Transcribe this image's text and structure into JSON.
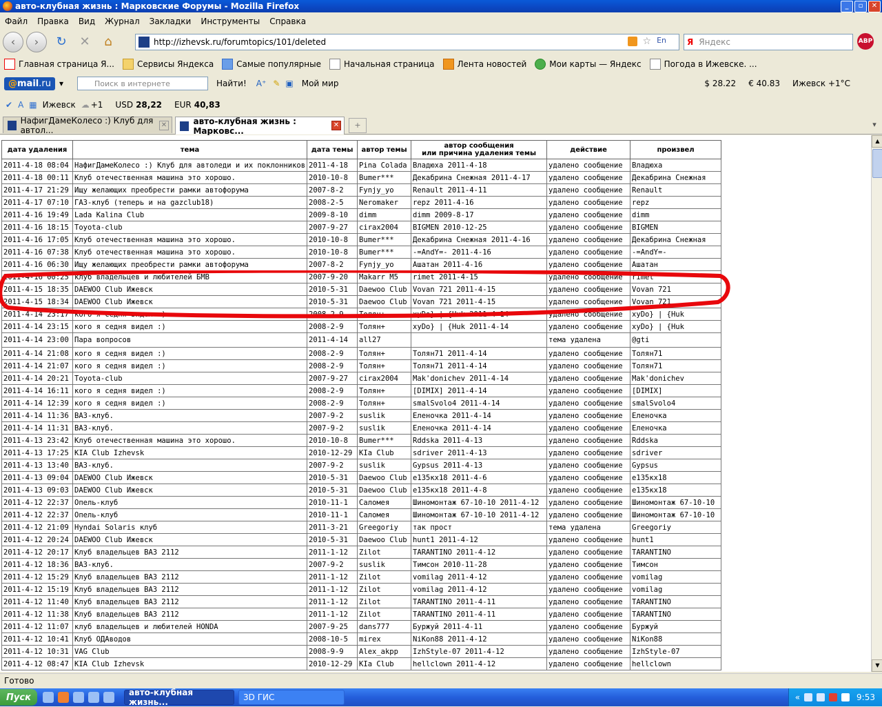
{
  "window": {
    "title": "авто-клубная жизнь : Марковские Форумы - Mozilla Firefox"
  },
  "menu": [
    "Файл",
    "Правка",
    "Вид",
    "Журнал",
    "Закладки",
    "Инструменты",
    "Справка"
  ],
  "nav": {
    "url": "http://izhevsk.ru/forumtopics/101/deleted",
    "lang": "En",
    "search_placeholder": "Яндекс",
    "abp": "ABP"
  },
  "bookmarks": [
    "Главная страница Я...",
    "Сервисы Яндекса",
    "Самые популярные",
    "Начальная страница",
    "Лента новостей",
    "Мои карты — Яндекс",
    "Погода в Ижевске. ..."
  ],
  "mailbar": {
    "logo_prefix": "@",
    "logo_main": "mail",
    "logo_suffix": ".ru",
    "search_placeholder": "Поиск в интернете",
    "find": "Найти!",
    "myworld": "Мой мир",
    "rate_usd": "$ 28.22",
    "rate_eur": "€ 40.83",
    "weather": "Ижевск +1°C"
  },
  "toolbar2": {
    "city": "Ижевск",
    "temp": "+1",
    "usd_label": "USD",
    "usd_value": "28,22",
    "eur_label": "EUR",
    "eur_value": "40,83"
  },
  "tabs": [
    {
      "label": "НафигДамеКолесо :) Клуб для автол...",
      "active": false
    },
    {
      "label": "авто-клубная жизнь : Марковс...",
      "active": true
    }
  ],
  "table": {
    "headers": [
      "дата удаления",
      "тема",
      "дата темы",
      "автор темы",
      "автор сообщения\nили причина удаления темы",
      "действие",
      "произвел"
    ],
    "rows": [
      [
        "2011-4-18 08:04",
        "НафигДамеКолесо :) Клуб для автоледи и их поклонников",
        "2011-4-18",
        "Pina Colada",
        "Владюха 2011-4-18",
        "удалено сообщение",
        "Владюха"
      ],
      [
        "2011-4-18 00:11",
        "Клуб отечественная машина это хорошо.",
        "2010-10-8",
        "Bumer***",
        "Декабрина Снежная 2011-4-17",
        "удалено сообщение",
        "Декабрина Снежная"
      ],
      [
        "2011-4-17 21:29",
        "Ищу желающих преобрести рамки автофорума",
        "2007-8-2",
        "Fynjy_yo",
        "Renault 2011-4-11",
        "удалено сообщение",
        "Renault"
      ],
      [
        "2011-4-17 07:10",
        "ГАЗ-клуб (теперь и на gazclub18)",
        "2008-2-5",
        "Neromaker",
        "repz 2011-4-16",
        "удалено сообщение",
        "repz"
      ],
      [
        "2011-4-16 19:49",
        "Lada Kalina Club",
        "2009-8-10",
        "dimm",
        "dimm 2009-8-17",
        "удалено сообщение",
        "dimm"
      ],
      [
        "2011-4-16 18:15",
        "Toyota-club",
        "2007-9-27",
        "cirax2004",
        "BIGMEN 2010-12-25",
        "удалено сообщение",
        "BIGMEN"
      ],
      [
        "2011-4-16 17:05",
        "Клуб отечественная машина это хорошо.",
        "2010-10-8",
        "Bumer***",
        "Декабрина Снежная 2011-4-16",
        "удалено сообщение",
        "Декабрина Снежная"
      ],
      [
        "2011-4-16 07:38",
        "Клуб отечественная машина это хорошо.",
        "2010-10-8",
        "Bumer***",
        "-=AndY=- 2011-4-16",
        "удалено сообщение",
        "-=AndY=-"
      ],
      [
        "2011-4-16 06:30",
        "Ищу желающих преобрести рамки автофорума",
        "2007-8-2",
        "Fynjy_yo",
        "Ашатан 2011-4-16",
        "удалено сообщение",
        "Ашатан"
      ],
      [
        "2011-4-16 00:25",
        "клуб владельцев и любителей БМВ",
        "2007-9-20",
        "Makarr M5",
        "rimet 2011-4-15",
        "удалено сообщение",
        "rimet"
      ],
      [
        "2011-4-15 18:35",
        "DAEWOO Club Ижевск",
        "2010-5-31",
        "Daewoo Club",
        "Vovan 721 2011-4-15",
        "удалено сообщение",
        "Vovan 721"
      ],
      [
        "2011-4-15 18:34",
        "DAEWOO Club Ижевск",
        "2010-5-31",
        "Daewoo Club",
        "Vovan 721 2011-4-15",
        "удалено сообщение",
        "Vovan 721"
      ],
      [
        "2011-4-14 23:17",
        "кого я седня видел :)",
        "2008-2-9",
        "Толян+",
        "xyDo} | {Huk 2011-4-14",
        "удалено сообщение",
        "xyDo} | {Huk"
      ],
      [
        "2011-4-14 23:15",
        "кого я седня видел :)",
        "2008-2-9",
        "Толян+",
        "xyDo} | {Huk 2011-4-14",
        "удалено сообщение",
        "xyDo} | {Huk"
      ],
      [
        "2011-4-14 23:00",
        "Пара вопросов",
        "2011-4-14",
        "all27",
        "",
        "тема удалена",
        "@gti"
      ],
      [
        "2011-4-14 21:08",
        "кого я седня видел :)",
        "2008-2-9",
        "Толян+",
        "Толян71 2011-4-14",
        "удалено сообщение",
        "Толян71"
      ],
      [
        "2011-4-14 21:07",
        "кого я седня видел :)",
        "2008-2-9",
        "Толян+",
        "Толян71 2011-4-14",
        "удалено сообщение",
        "Толян71"
      ],
      [
        "2011-4-14 20:21",
        "Toyota-club",
        "2007-9-27",
        "cirax2004",
        "Mak'donichev 2011-4-14",
        "удалено сообщение",
        "Mak'donichev"
      ],
      [
        "2011-4-14 16:11",
        "кого я седня видел :)",
        "2008-2-9",
        "Толян+",
        "[DIMIX] 2011-4-14",
        "удалено сообщение",
        "[DIMIX]"
      ],
      [
        "2011-4-14 12:39",
        "кого я седня видел :)",
        "2008-2-9",
        "Толян+",
        "smalSvolo4 2011-4-14",
        "удалено сообщение",
        "smalSvolo4"
      ],
      [
        "2011-4-14 11:36",
        "ВАЗ-клуб.",
        "2007-9-2",
        "suslik",
        "Еленочка 2011-4-14",
        "удалено сообщение",
        "Еленочка"
      ],
      [
        "2011-4-14 11:31",
        "ВАЗ-клуб.",
        "2007-9-2",
        "suslik",
        "Еленочка 2011-4-14",
        "удалено сообщение",
        "Еленочка"
      ],
      [
        "2011-4-13 23:42",
        "Клуб отечественная машина это хорошо.",
        "2010-10-8",
        "Bumer***",
        "Rddska 2011-4-13",
        "удалено сообщение",
        "Rddska"
      ],
      [
        "2011-4-13 17:25",
        "KIA Club Izhevsk",
        "2010-12-29",
        "KIa Club",
        "sdriver 2011-4-13",
        "удалено сообщение",
        "sdriver"
      ],
      [
        "2011-4-13 13:40",
        "ВАЗ-клуб.",
        "2007-9-2",
        "suslik",
        "Gypsus 2011-4-13",
        "удалено сообщение",
        "Gypsus"
      ],
      [
        "2011-4-13 09:04",
        "DAEWOO Club Ижевск",
        "2010-5-31",
        "Daewoo Club",
        "e135кx18 2011-4-6",
        "удалено сообщение",
        "e135кx18"
      ],
      [
        "2011-4-13 09:03",
        "DAEWOO Club Ижевск",
        "2010-5-31",
        "Daewoo Club",
        "e135кx18 2011-4-8",
        "удалено сообщение",
        "e135кx18"
      ],
      [
        "2011-4-12 22:37",
        "Опель-клуб",
        "2010-11-1",
        "Саломея",
        "Шиномонтаж 67-10-10 2011-4-12",
        "удалено сообщение",
        "Шиномонтаж 67-10-10"
      ],
      [
        "2011-4-12 22:37",
        "Опель-клуб",
        "2010-11-1",
        "Саломея",
        "Шиномонтаж 67-10-10 2011-4-12",
        "удалено сообщение",
        "Шиномонтаж 67-10-10"
      ],
      [
        "2011-4-12 21:09",
        "Hyndai Solaris клуб",
        "2011-3-21",
        "Greegoriy",
        "так прост",
        "тема удалена",
        "Greegoriy"
      ],
      [
        "2011-4-12 20:24",
        "DAEWOO Club Ижевск",
        "2010-5-31",
        "Daewoo Club",
        "hunt1 2011-4-12",
        "удалено сообщение",
        "hunt1"
      ],
      [
        "2011-4-12 20:17",
        "Клуб владельцев ВАЗ 2112",
        "2011-1-12",
        "Zilot",
        "TARANTINO 2011-4-12",
        "удалено сообщение",
        "TARANTINO"
      ],
      [
        "2011-4-12 18:36",
        "ВАЗ-клуб.",
        "2007-9-2",
        "suslik",
        "Тимсон 2010-11-28",
        "удалено сообщение",
        "Тимсон"
      ],
      [
        "2011-4-12 15:29",
        "Клуб владельцев ВАЗ 2112",
        "2011-1-12",
        "Zilot",
        "vomilag 2011-4-12",
        "удалено сообщение",
        "vomilag"
      ],
      [
        "2011-4-12 15:19",
        "Клуб владельцев ВАЗ 2112",
        "2011-1-12",
        "Zilot",
        "vomilag 2011-4-12",
        "удалено сообщение",
        "vomilag"
      ],
      [
        "2011-4-12 11:40",
        "Клуб владельцев ВАЗ 2112",
        "2011-1-12",
        "Zilot",
        "TARANTINO 2011-4-11",
        "удалено сообщение",
        "TARANTINO"
      ],
      [
        "2011-4-12 11:38",
        "Клуб владельцев ВАЗ 2112",
        "2011-1-12",
        "Zilot",
        "TARANTINO 2011-4-11",
        "удалено сообщение",
        "TARANTINO"
      ],
      [
        "2011-4-12 11:07",
        "клуб владельцев и любителей HONDA",
        "2007-9-25",
        "dans777",
        "Буржуй 2011-4-11",
        "удалено сообщение",
        "Буржуй"
      ],
      [
        "2011-4-12 10:41",
        "Клуб ОДАводов",
        "2008-10-5",
        "mirex",
        "NiKon88 2011-4-12",
        "удалено сообщение",
        "NiKon88"
      ],
      [
        "2011-4-12 10:31",
        "VAG Club",
        "2008-9-9",
        "Alex_akpp",
        "IzhStyle-07 2011-4-12",
        "удалено сообщение",
        "IzhStyle-07"
      ],
      [
        "2011-4-12 08:47",
        "KIA Club Izhevsk",
        "2010-12-29",
        "KIa Club",
        "hellclown 2011-4-12",
        "удалено сообщение",
        "hellclown"
      ]
    ]
  },
  "status": "Готово",
  "taskbar": {
    "start": "Пуск",
    "tasks": [
      "авто-клубная жизнь...",
      "3D ГИС"
    ],
    "tray_lang": "«",
    "clock": "9:53"
  },
  "colors": {
    "annotation": "#e8080c",
    "titlebar": "#0b47c2"
  }
}
